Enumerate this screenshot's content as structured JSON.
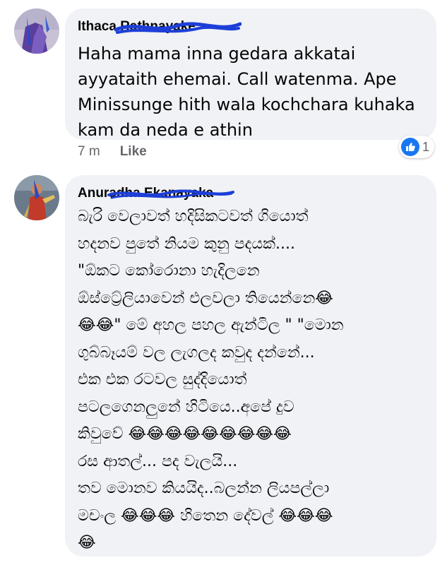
{
  "comments": [
    {
      "author": "Ithaca Rathnayake",
      "text": "Haha mama inna gedara akkatai\nayyataith ehemai. Call watenma. Ape\nMinissunge hith wala kochchara kuhaka\nkam da neda e athin",
      "time": "7 m",
      "like_label": "Like",
      "reaction_count": "1",
      "reaction_icon": "thumbs-up-icon"
    },
    {
      "author": "Anuradha Ekanayaka",
      "text": "බැරි වෙලාවත් හදිසිකටවත් ගියොත්\nහදනව පුතේ නියම කුනු පදයක්....\n\"ඕකට කෝරොනා හැදිලනෙ\nඕස්ට්‍රේලියාවෙන් එලවලා තියෙන්නෙ😂\n😂😂\" මේ අහල පහල ඇන්ටිල \" \"මොන\nගුබ්බෑයම් වල ලැගලද කවුද දන්නේ...\nඑක එක රටවල සුද්දියොත්\nපටලගෙනලුනේ හිටියෙ..අපේ දුව\nකිවුවේ 😂😂😂😂😂😂😂😂😂\nරස ආතල්... පද වැලයි...\nතව මොනව කියයිද..බලන්න ලියපල්ලා\nමචංල 😂😂😂 හිතෙන දේවල් 😂😂😂\n😂"
    }
  ],
  "colors": {
    "bubble": "#f0f2f5",
    "meta": "#65676b",
    "like_blue": "#1877f2",
    "scribble_blue": "#1d3fd8"
  }
}
